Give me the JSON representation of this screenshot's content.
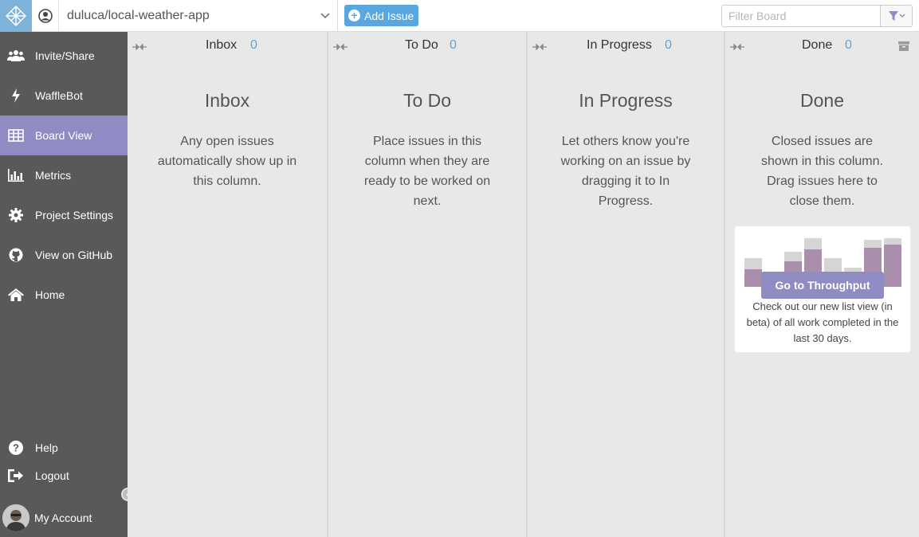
{
  "topbar": {
    "repo_name": "duluca/local-weather-app",
    "add_issue_label": "Add Issue",
    "filter_placeholder": "Filter Board"
  },
  "sidebar": {
    "items": [
      {
        "label": "Invite/Share",
        "icon": "users-icon"
      },
      {
        "label": "WaffleBot",
        "icon": "bolt-icon"
      },
      {
        "label": "Board View",
        "icon": "table-icon",
        "active": true
      },
      {
        "label": "Metrics",
        "icon": "bar-chart-icon"
      },
      {
        "label": "Project Settings",
        "icon": "gear-icon"
      },
      {
        "label": "View on GitHub",
        "icon": "github-icon"
      },
      {
        "label": "Home",
        "icon": "home-icon"
      }
    ],
    "bottom": [
      {
        "label": "Help",
        "icon": "question-icon"
      },
      {
        "label": "Logout",
        "icon": "logout-icon"
      },
      {
        "label": "My Account",
        "icon": "avatar"
      }
    ]
  },
  "columns": [
    {
      "title": "Inbox",
      "count": "0",
      "heading": "Inbox",
      "description": "Any open issues automatically show up in this column."
    },
    {
      "title": "To Do",
      "count": "0",
      "heading": "To Do",
      "description": "Place issues in this column when they are ready to be worked on next."
    },
    {
      "title": "In Progress",
      "count": "0",
      "heading": "In Progress",
      "description": "Let others know you're working on an issue by dragging it to In Progress."
    },
    {
      "title": "Done",
      "count": "0",
      "heading": "Done",
      "description": "Closed issues are shown in this column. Drag issues here to close them."
    }
  ],
  "throughput": {
    "button_label": "Go to Throughput",
    "text": "Check out our new list view (in beta) of all work completed in the last 30 days."
  },
  "colors": {
    "sidebar_bg": "#595959",
    "accent": "#8f8bc3",
    "link_blue": "#5aa6e0"
  }
}
